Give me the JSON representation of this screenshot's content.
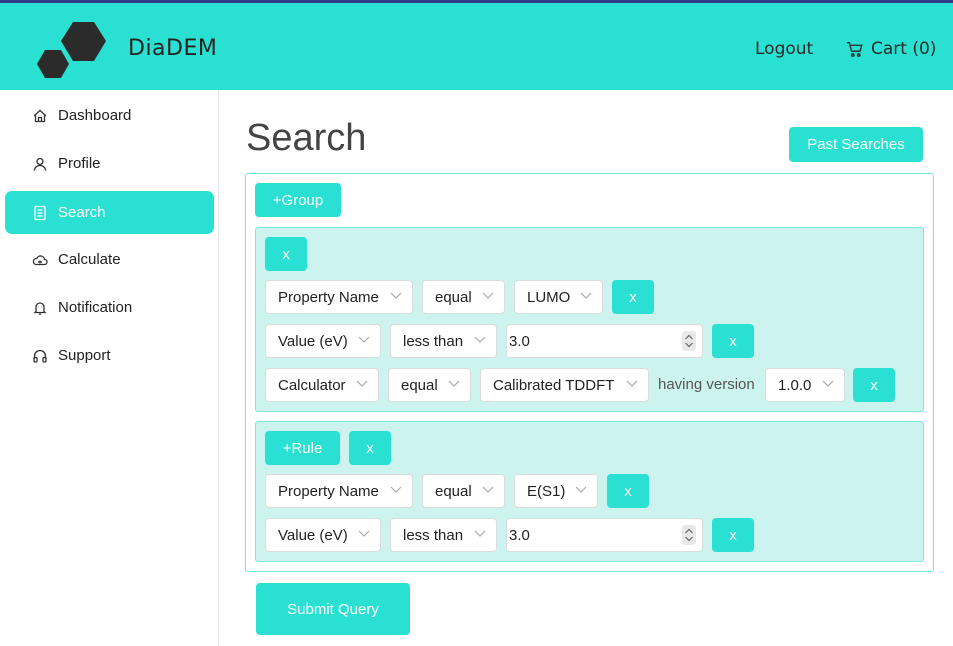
{
  "app": {
    "brand": "DiaDEM",
    "logout_label": "Logout",
    "cart_label": "Cart (0)"
  },
  "colors": {
    "accent": "#2ae0d2",
    "group_bg": "#cdf3ee",
    "text": "#222222"
  },
  "sidebar": {
    "items": [
      {
        "label": "Dashboard",
        "icon": "home-icon",
        "active": false
      },
      {
        "label": "Profile",
        "icon": "user-icon",
        "active": false
      },
      {
        "label": "Search",
        "icon": "list-icon",
        "active": true
      },
      {
        "label": "Calculate",
        "icon": "cloud-icon",
        "active": false
      },
      {
        "label": "Notification",
        "icon": "bell-icon",
        "active": false
      },
      {
        "label": "Support",
        "icon": "headset-icon",
        "active": false
      }
    ]
  },
  "main": {
    "title": "Search",
    "past_searches_label": "Past Searches",
    "add_group_label": "+Group",
    "remove_label": "x",
    "add_rule_label": "+Rule",
    "having_version_label": "having version",
    "submit_label": "Submit Query",
    "group1": {
      "rule1": {
        "field": "Property Name",
        "operator": "equal",
        "value": "LUMO"
      },
      "rule2": {
        "field": "Value (eV)",
        "operator": "less than",
        "value": "3.0"
      },
      "rule3": {
        "field": "Calculator",
        "operator": "equal",
        "value": "Calibrated TDDFT",
        "version": "1.0.0"
      }
    },
    "group2": {
      "rule1": {
        "field": "Property Name",
        "operator": "equal",
        "value": "E(S1)"
      },
      "rule2": {
        "field": "Value (eV)",
        "operator": "less than",
        "value": "3.0"
      }
    }
  }
}
